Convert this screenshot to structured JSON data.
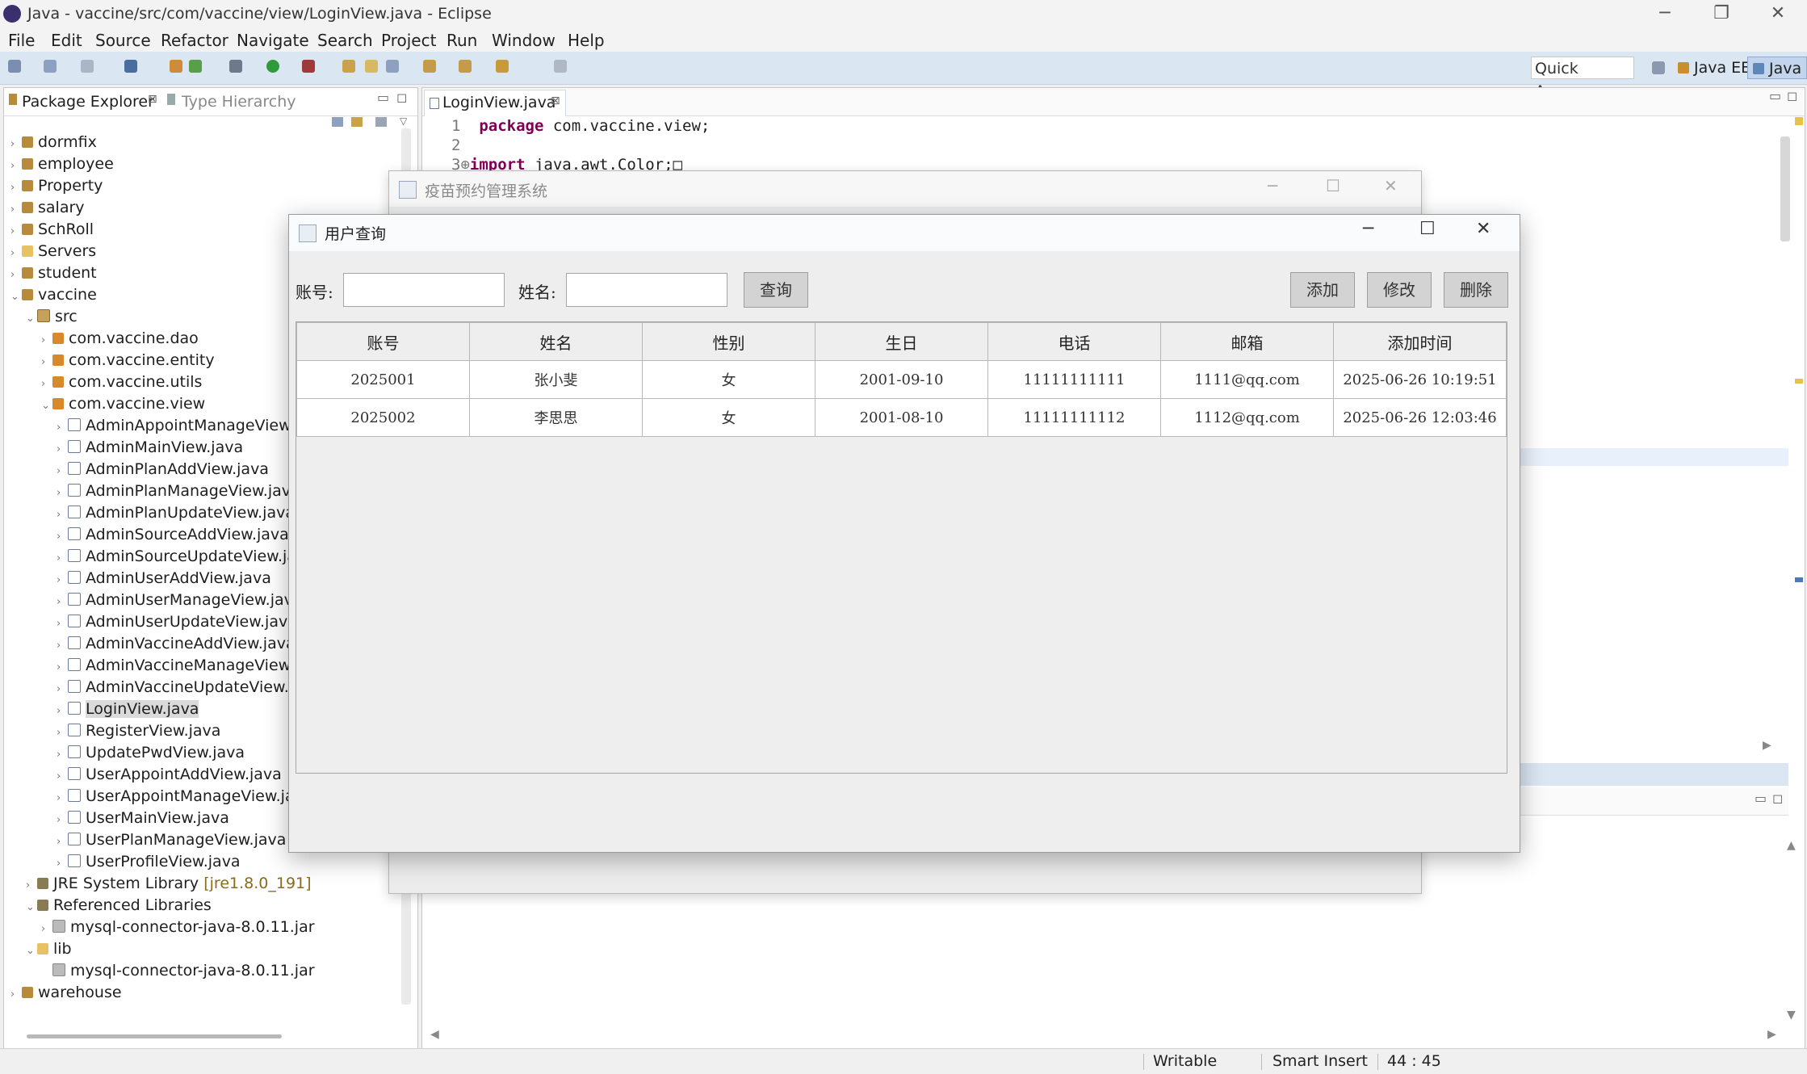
{
  "window": {
    "title": "Java - vaccine/src/com/vaccine/view/LoginView.java - Eclipse",
    "controls": {
      "minimize": "─",
      "restore": "❐",
      "close": "✕"
    }
  },
  "menu": [
    "File",
    "Edit",
    "Source",
    "Refactor",
    "Navigate",
    "Search",
    "Project",
    "Run",
    "Window",
    "Help"
  ],
  "toolbar": {
    "quick_access": "Quick Access",
    "perspectives": [
      "Java EE",
      "Java"
    ]
  },
  "package_explorer": {
    "tab_active": "Package Explorer",
    "tab_inactive": "Type Hierarchy",
    "tree": [
      {
        "label": "dormfix",
        "icon": "project-icon"
      },
      {
        "label": "employee",
        "icon": "project-icon"
      },
      {
        "label": "Property",
        "icon": "project-icon"
      },
      {
        "label": "salary",
        "icon": "project-icon"
      },
      {
        "label": "SchRoll",
        "icon": "project-icon"
      },
      {
        "label": "Servers",
        "icon": "folder-icon"
      },
      {
        "label": "student",
        "icon": "project-icon"
      },
      {
        "label": "vaccine",
        "icon": "project-icon"
      },
      {
        "label": "src",
        "icon": "source-folder-icon"
      },
      {
        "label": "com.vaccine.dao",
        "icon": "package-icon"
      },
      {
        "label": "com.vaccine.entity",
        "icon": "package-icon"
      },
      {
        "label": "com.vaccine.utils",
        "icon": "package-icon"
      },
      {
        "label": "com.vaccine.view",
        "icon": "package-icon"
      },
      {
        "label": "AdminAppointManageView.ja",
        "icon": "java-file-icon"
      },
      {
        "label": "AdminMainView.java",
        "icon": "java-file-icon"
      },
      {
        "label": "AdminPlanAddView.java",
        "icon": "java-file-icon"
      },
      {
        "label": "AdminPlanManageView.java",
        "icon": "java-file-icon"
      },
      {
        "label": "AdminPlanUpdateView.java",
        "icon": "java-file-icon"
      },
      {
        "label": "AdminSourceAddView.java",
        "icon": "java-file-icon"
      },
      {
        "label": "AdminSourceUpdateView.java",
        "icon": "java-file-icon"
      },
      {
        "label": "AdminUserAddView.java",
        "icon": "java-file-icon"
      },
      {
        "label": "AdminUserManageView.java",
        "icon": "java-file-icon"
      },
      {
        "label": "AdminUserUpdateView.java",
        "icon": "java-file-icon"
      },
      {
        "label": "AdminVaccineAddView.java",
        "icon": "java-file-icon"
      },
      {
        "label": "AdminVaccineManageView.ja",
        "icon": "java-file-icon"
      },
      {
        "label": "AdminVaccineUpdateView.jav",
        "icon": "java-file-icon"
      },
      {
        "label": "LoginView.java",
        "icon": "java-file-icon"
      },
      {
        "label": "RegisterView.java",
        "icon": "java-file-icon"
      },
      {
        "label": "UpdatePwdView.java",
        "icon": "java-file-icon"
      },
      {
        "label": "UserAppointAddView.java",
        "icon": "java-file-icon"
      },
      {
        "label": "UserAppointManageView.java",
        "icon": "java-file-icon"
      },
      {
        "label": "UserMainView.java",
        "icon": "java-file-icon"
      },
      {
        "label": "UserPlanManageView.java",
        "icon": "java-file-icon"
      },
      {
        "label": "UserProfileView.java",
        "icon": "java-file-icon"
      },
      {
        "label": "JRE System Library",
        "suffix": "[jre1.8.0_191]",
        "icon": "library-icon"
      },
      {
        "label": "Referenced Libraries",
        "icon": "library-icon"
      },
      {
        "label": "mysql-connector-java-8.0.11.jar",
        "icon": "jar-icon"
      },
      {
        "label": "lib",
        "icon": "folder-icon"
      },
      {
        "label": "mysql-connector-java-8.0.11.jar",
        "icon": "jar-icon"
      },
      {
        "label": "warehouse",
        "icon": "project-icon"
      }
    ]
  },
  "editor": {
    "tab": "LoginView.java",
    "lines": [
      {
        "num": "1",
        "kw": "package",
        "rest": " com.vaccine.view;"
      },
      {
        "num": "2",
        "kw": "",
        "rest": ""
      },
      {
        "num": "3⊕",
        "kw": "import",
        "rest": " java.awt.Color;□"
      }
    ]
  },
  "status": {
    "writable": "Writable",
    "insert_mode": "Smart Insert",
    "position": "44 : 45"
  },
  "parent_window": {
    "title": "疫苗预约管理系统"
  },
  "dialog": {
    "title": "用户查询",
    "account_label": "账号:",
    "account_value": "",
    "name_label": "姓名:",
    "name_value": "",
    "query_button": "查询",
    "add_button": "添加",
    "edit_button": "修改",
    "delete_button": "删除",
    "columns": [
      "账号",
      "姓名",
      "性别",
      "生日",
      "电话",
      "邮箱",
      "添加时间"
    ],
    "rows": [
      [
        "2025001",
        "张小斐",
        "女",
        "2001-09-10",
        "11111111111",
        "1111@qq.com",
        "2025-06-26 10:19:51"
      ],
      [
        "2025002",
        "李思思",
        "女",
        "2001-08-10",
        "11111111112",
        "1112@qq.com",
        "2025-06-26 12:03:46"
      ]
    ]
  }
}
